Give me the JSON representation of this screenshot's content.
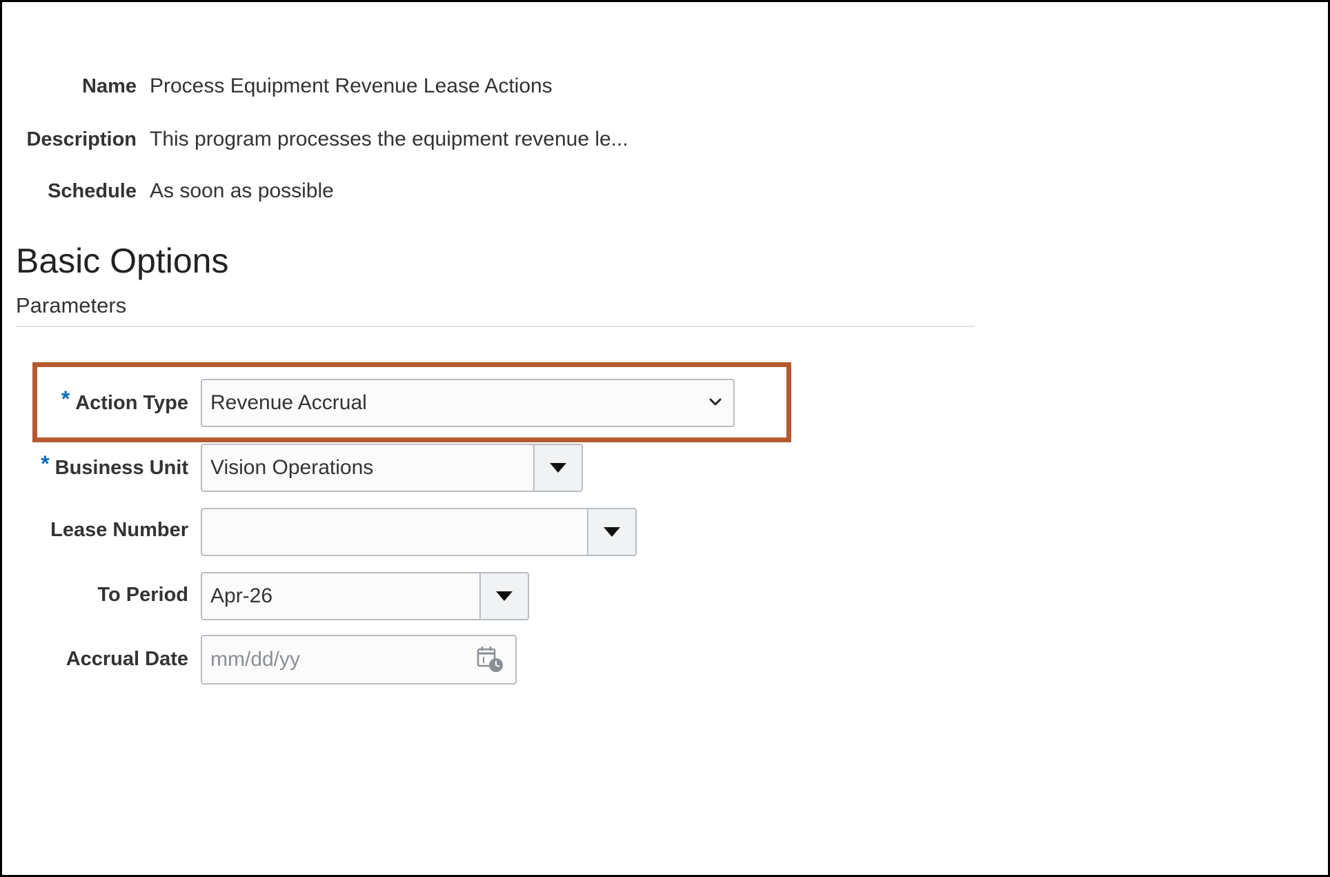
{
  "summary": {
    "name_label": "Name",
    "name_value": "Process Equipment Revenue Lease Actions",
    "description_label": "Description",
    "description_value": "This program processes the equipment revenue le...",
    "schedule_label": "Schedule",
    "schedule_value": "As soon as possible"
  },
  "section": {
    "title": "Basic Options",
    "subtitle": "Parameters"
  },
  "form": {
    "required_marker": "*",
    "action_type": {
      "label": "Action Type",
      "value": "Revenue Accrual",
      "required": true
    },
    "business_unit": {
      "label": "Business Unit",
      "value": "Vision Operations",
      "required": true
    },
    "lease_number": {
      "label": "Lease Number",
      "value": "",
      "required": false
    },
    "to_period": {
      "label": "To Period",
      "value": "Apr-26",
      "required": false
    },
    "accrual_date": {
      "label": "Accrual Date",
      "placeholder": "mm/dd/yy",
      "required": false
    }
  },
  "icons": {
    "select": "chevron-down-icon",
    "dropdown": "triangle-down-icon",
    "date": "calendar-clock-icon"
  },
  "colors": {
    "required_marker": "#0b6cb6",
    "highlight_border": "#b45a2e",
    "field_border": "#b6bdc4"
  }
}
